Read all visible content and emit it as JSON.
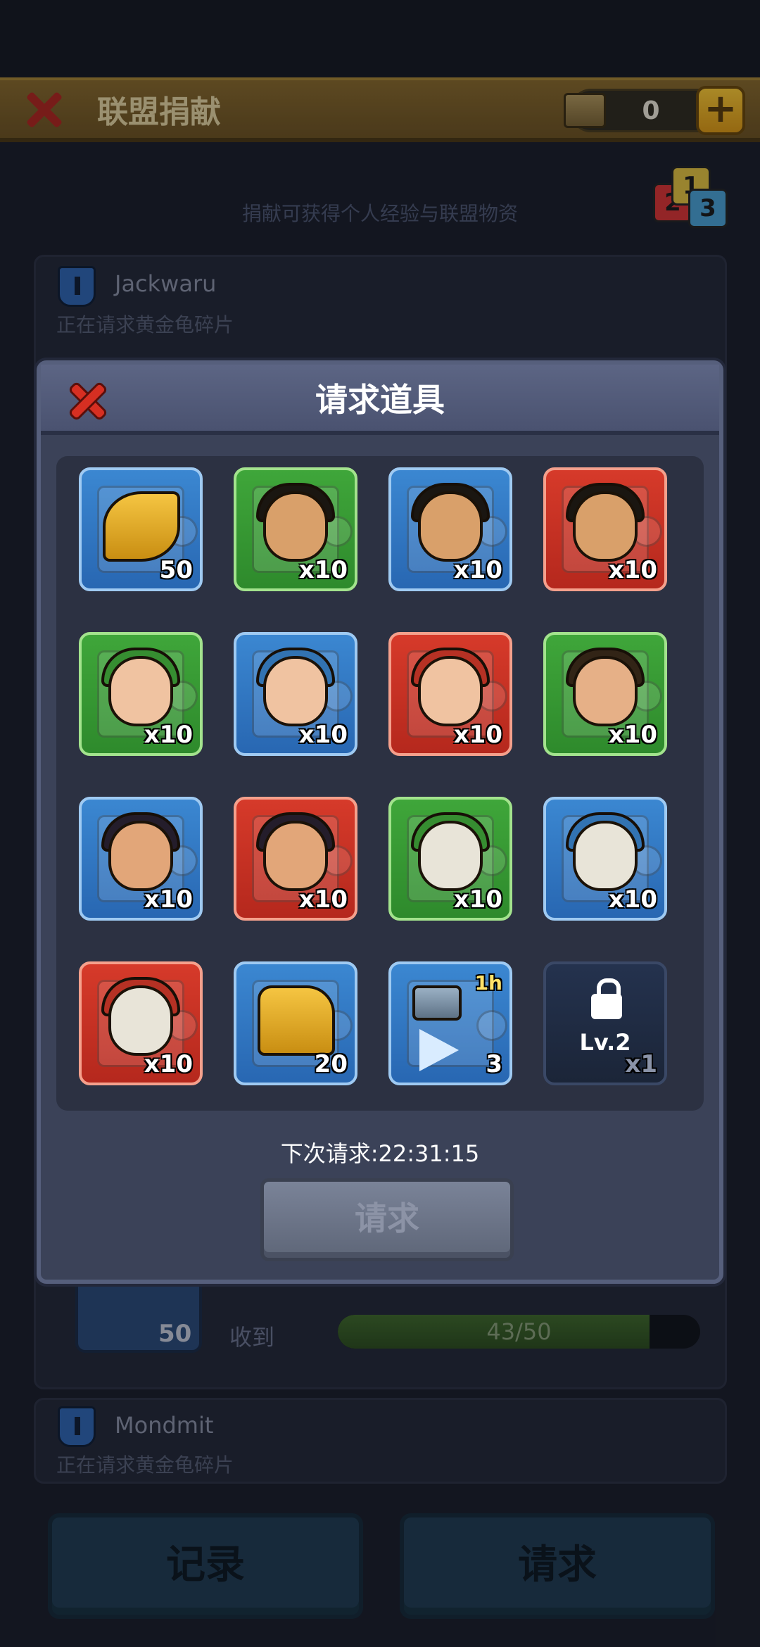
{
  "header": {
    "title": "联盟捐献",
    "resource_value": "0"
  },
  "hint": "捐献可获得个人经验与联盟物资",
  "dice": {
    "d1": "2",
    "d2": "1",
    "d3": "3"
  },
  "requests": [
    {
      "name": "Jackwaru",
      "status": "正在请求黄金龟碎片"
    },
    {
      "name": "Mondmit",
      "status": "正在请求黄金龟碎片"
    }
  ],
  "received": {
    "piece_count": "50",
    "label": "收到",
    "progress_text": "43/50",
    "progress_fraction": 0.86
  },
  "bottom": {
    "records_label": "记录",
    "request_label": "请求"
  },
  "modal": {
    "title": "请求道具",
    "next_request": "下次请求:22:31:15",
    "request_button": "请求",
    "items": [
      {
        "icon": "golden-turtle-piece-icon",
        "color": "blue",
        "count": "50"
      },
      {
        "icon": "hero-man-piece-icon",
        "color": "green",
        "count": "x10"
      },
      {
        "icon": "hero-man-piece-icon",
        "color": "blue",
        "count": "x10"
      },
      {
        "icon": "hero-man-piece-icon",
        "color": "red",
        "count": "x10"
      },
      {
        "icon": "hero-elf-piece-icon",
        "color": "green",
        "count": "x10"
      },
      {
        "icon": "hero-elf-piece-icon",
        "color": "blue",
        "count": "x10"
      },
      {
        "icon": "hero-elf-piece-icon",
        "color": "red",
        "count": "x10"
      },
      {
        "icon": "hero-woman-piece-icon",
        "color": "green",
        "count": "x10"
      },
      {
        "icon": "hero-horned-woman-piece-icon",
        "color": "blue",
        "count": "x10"
      },
      {
        "icon": "hero-horned-woman-piece-icon",
        "color": "red",
        "count": "x10"
      },
      {
        "icon": "dragon-piece-icon",
        "color": "green",
        "count": "x10"
      },
      {
        "icon": "dragon-piece-icon",
        "color": "blue",
        "count": "x10"
      },
      {
        "icon": "dragon-piece-icon",
        "color": "red",
        "count": "x10"
      },
      {
        "icon": "golden-turtle-icon",
        "color": "blue",
        "count": "20"
      },
      {
        "icon": "hammer-speedup-icon",
        "color": "blue",
        "count": "3",
        "badge": "1h"
      },
      {
        "icon": "locked-slot-icon",
        "color": "dark",
        "count": "x1",
        "lock_label": "Lv.2"
      }
    ]
  },
  "colors": {
    "blue": "#3b87d1",
    "green": "#3fa63a",
    "red": "#d63a2a",
    "dark": "#24324e"
  }
}
